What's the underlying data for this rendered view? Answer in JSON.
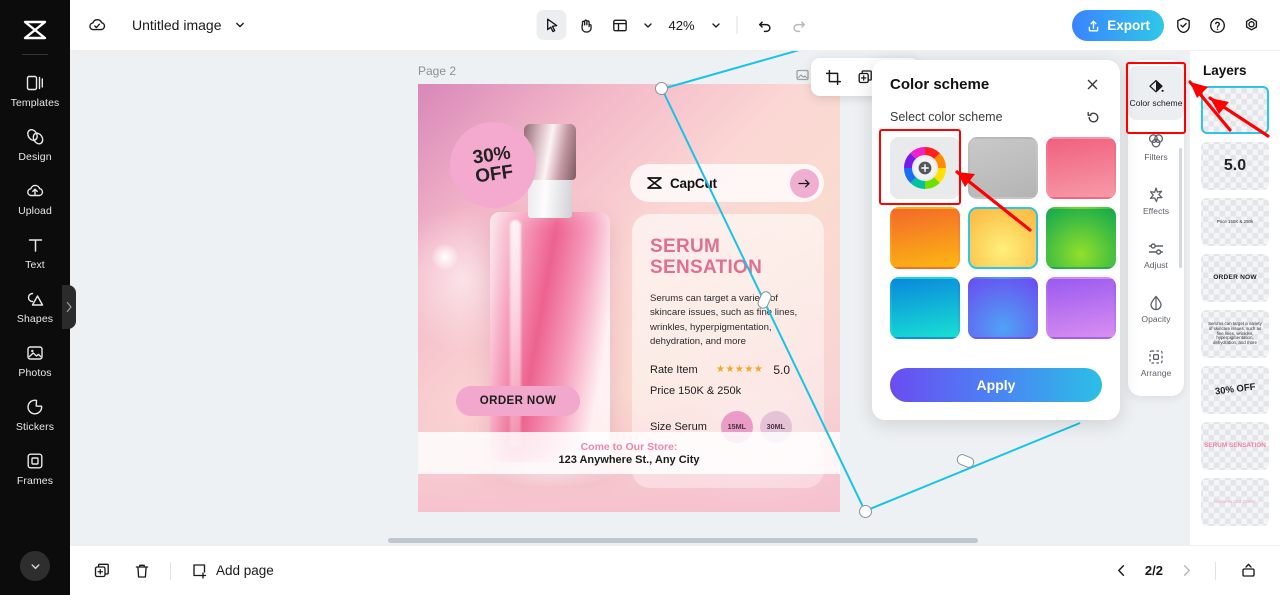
{
  "app": {
    "brand": "capcut-logo",
    "doc_title": "Untitled image",
    "zoom_level": "42%"
  },
  "sidebar": {
    "items": [
      {
        "label": "Templates",
        "icon": "templates-icon"
      },
      {
        "label": "Design",
        "icon": "design-icon"
      },
      {
        "label": "Upload",
        "icon": "upload-cloud-icon"
      },
      {
        "label": "Text",
        "icon": "text-icon"
      },
      {
        "label": "Shapes",
        "icon": "shapes-icon"
      },
      {
        "label": "Photos",
        "icon": "photos-icon"
      },
      {
        "label": "Stickers",
        "icon": "stickers-icon"
      },
      {
        "label": "Frames",
        "icon": "frames-icon"
      }
    ],
    "more_icon": "chevron-down-icon",
    "collapse_icon": "chevron-right-icon"
  },
  "toolbar": {
    "cloud_icon": "cloud-saved-icon",
    "title_caret_icon": "chevron-down-icon",
    "select_tool_icon": "cursor-arrow-icon",
    "hand_tool_icon": "hand-icon",
    "layout_tool_icon": "layout-grid-icon",
    "layout_caret_icon": "chevron-down-icon",
    "zoom_caret_icon": "chevron-down-icon",
    "undo_icon": "undo-icon",
    "redo_icon": "redo-icon",
    "export_label": "Export",
    "export_icon": "upload-share-icon",
    "shield_icon": "shield-check-icon",
    "help_icon": "question-circle-icon",
    "settings_icon": "gear-icon"
  },
  "canvas": {
    "page_label": "Page 2",
    "object_toolbar": {
      "crop_icon": "crop-icon",
      "duplicate_icon": "duplicate-icon",
      "delete_icon": "trash-icon",
      "behind_icon": "image-layer-icon"
    }
  },
  "poster": {
    "capcut_label": "CapCut",
    "capcut_arrow_icon": "arrow-right-icon",
    "title_line1": "SERUM",
    "title_line2": "SENSATION",
    "description": "Serums can target a variety of skincare issues, such as fine lines, wrinkles, hyperpigmentation, dehydration, and more",
    "rate_label": "Rate Item",
    "stars": "★★★★★",
    "rate_value": "5.0",
    "price": "Price 150K & 250k",
    "size_label": "Size Serum",
    "size_option_1": "15ML",
    "size_option_2": "30ML",
    "discount_line1": "30%",
    "discount_line2": "OFF",
    "order_now": "ORDER NOW",
    "store_heading": "Come to Our Store:",
    "store_address": "123 Anywhere St., Any City"
  },
  "color_scheme_panel": {
    "title": "Color scheme",
    "close_icon": "close-x-icon",
    "subtitle": "Select color scheme",
    "reset_icon": "reset-rotate-icon",
    "apply_label": "Apply",
    "swatches": [
      {
        "name": "custom-color-wheel",
        "type": "wheel",
        "selected": false
      },
      {
        "name": "gray-gradient",
        "color_a": "#c9c9c9",
        "color_b": "#b4b4b4",
        "selected": false
      },
      {
        "name": "pink-gradient",
        "color_a": "#f0607f",
        "color_b": "#f79aa8",
        "selected": false
      },
      {
        "name": "orange-gradient",
        "color_a": "#f4682a",
        "color_b": "#fbb713",
        "selected": false
      },
      {
        "name": "yellow-gradient",
        "color_a": "#fcb63f",
        "color_b": "#fdf07a",
        "selected": true
      },
      {
        "name": "green-gradient",
        "color_a": "#12a84f",
        "color_b": "#92e02a",
        "selected": false
      },
      {
        "name": "cyan-gradient",
        "color_a": "#0a88dd",
        "color_b": "#18e0d2",
        "selected": false
      },
      {
        "name": "blue-gradient",
        "color_a": "#6a4df0",
        "color_b": "#4fa3f5",
        "selected": false
      },
      {
        "name": "purple-gradient",
        "color_a": "#9a5af0",
        "color_b": "#d98ef0",
        "selected": false
      }
    ]
  },
  "right_rail": {
    "items": [
      {
        "label": "Color scheme",
        "icon": "paint-drop-icon",
        "active": true
      },
      {
        "label": "Filters",
        "icon": "filters-circles-icon",
        "active": false
      },
      {
        "label": "Effects",
        "icon": "effects-sparkle-icon",
        "active": false
      },
      {
        "label": "Adjust",
        "icon": "sliders-icon",
        "active": false
      },
      {
        "label": "Opacity",
        "icon": "opacity-drop-icon",
        "active": false
      },
      {
        "label": "Arrange",
        "icon": "arrange-box-icon",
        "active": false
      }
    ]
  },
  "layers_panel": {
    "title": "Layers",
    "layers": [
      {
        "name": "selected-empty-layer",
        "text": "",
        "style": "empty",
        "selected": true
      },
      {
        "name": "rating-value-layer",
        "text": "5.0",
        "style": "big",
        "selected": false
      },
      {
        "name": "price-layer",
        "text": "Price 150K & 250k",
        "style": "tiny",
        "selected": false
      },
      {
        "name": "order-now-layer",
        "text": "ORDER NOW",
        "style": "small",
        "selected": false
      },
      {
        "name": "description-layer",
        "text": "Serums can target a variety of skincare issues, such as fine lines, wrinkles, hyperpigmentation, dehydration, and more",
        "style": "tiny",
        "selected": false
      },
      {
        "name": "discount-layer",
        "text": "30% OFF",
        "style": "rot",
        "selected": false
      },
      {
        "name": "serum-title-layer",
        "text": "SERUM SENSATION",
        "style": "pink",
        "selected": false
      },
      {
        "name": "store-layer",
        "text": "Come to Our Store:",
        "style": "pinkfaint",
        "selected": false
      }
    ]
  },
  "bottom_bar": {
    "duplicate_page_icon": "duplicate-page-icon",
    "delete_page_icon": "trash-icon",
    "add_page_label": "Add page",
    "add_page_icon": "add-page-icon",
    "prev_icon": "chevron-left-icon",
    "page_indicator": "2/2",
    "next_icon": "chevron-right-icon",
    "present_icon": "present-icon"
  },
  "colors": {
    "accent_cyan": "#2ec6e8",
    "annotation_red": "#ff0000",
    "export_gradient_start": "#3a84ff",
    "export_gradient_end": "#2fc8e8",
    "sidebar_bg": "#0c0c0c",
    "canvas_bg": "#eef1f4"
  }
}
